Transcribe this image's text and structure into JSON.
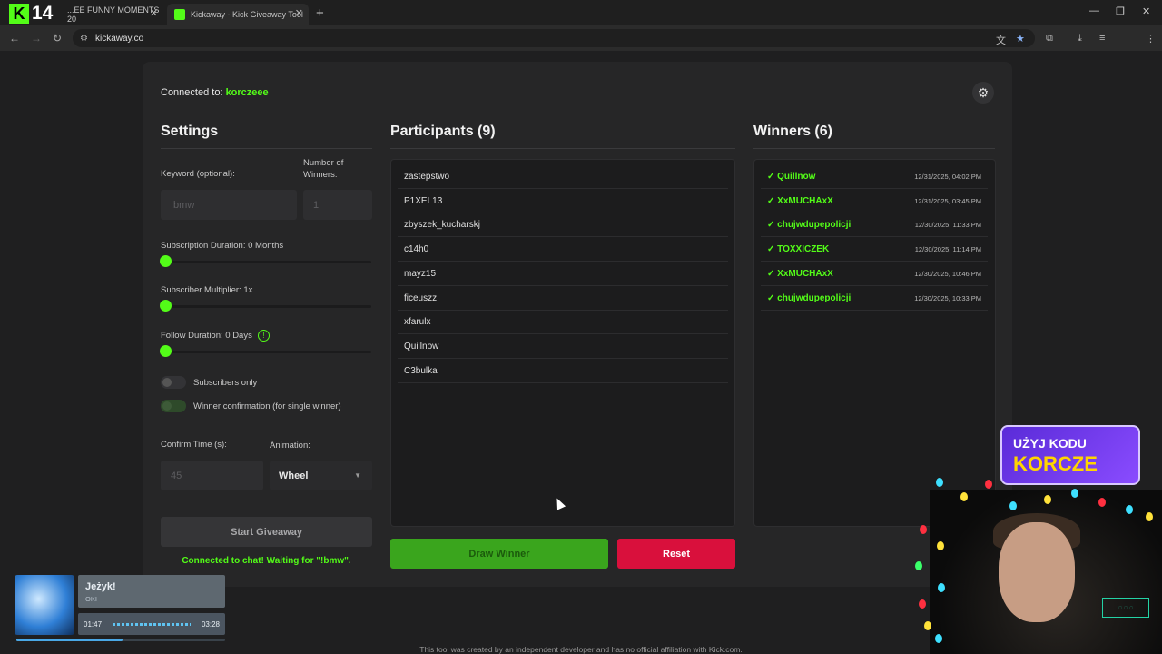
{
  "browser": {
    "tab1_title": "...EE FUNNY MOMENTS 20",
    "tab2_title": "Kickaway - Kick Giveaway Tool",
    "url": "kickaway.co",
    "new_tab": "+",
    "close": "✕",
    "profile_initial": "P"
  },
  "overlay_logo": {
    "k": "K",
    "number": "14"
  },
  "header": {
    "connected_label": "Connected to: ",
    "channel": "korczeee"
  },
  "settings": {
    "title": "Settings",
    "keyword_label": "Keyword (optional):",
    "keyword_placeholder": "!bmw",
    "winners_label": "Number of Winners:",
    "winners_placeholder": "1",
    "subscription_duration": "Subscription Duration: 0 Months",
    "subscriber_multiplier": "Subscriber Multiplier: 1x",
    "follow_duration": "Follow Duration: 0 Days",
    "subscribers_only": "Subscribers only",
    "winner_confirmation": "Winner confirmation (for single winner)",
    "confirm_time_label": "Confirm Time (s):",
    "confirm_time_placeholder": "45",
    "animation_label": "Animation:",
    "animation_value": "Wheel",
    "start_button": "Start Giveaway",
    "status": "Connected to chat! Waiting for \"!bmw\"."
  },
  "participants": {
    "title": "Participants (9)",
    "items": [
      "zastepstwo",
      "P1XEL13",
      "zbyszek_kucharskj",
      "c14h0",
      "mayz15",
      "ficeuszz",
      "xfarulx",
      "Quillnow",
      "C3bulka"
    ]
  },
  "winners": {
    "title": "Winners (6)",
    "items": [
      {
        "name": "✓ Quillnow",
        "date": "12/31/2025, 04:02 PM"
      },
      {
        "name": "✓ XxMUCHAxX",
        "date": "12/31/2025, 03:45 PM"
      },
      {
        "name": "✓ chujwdupepolicji",
        "date": "12/30/2025, 11:33 PM"
      },
      {
        "name": "✓ TOXXICZEK",
        "date": "12/30/2025, 11:14 PM"
      },
      {
        "name": "✓ XxMUCHAxX",
        "date": "12/30/2025, 10:46 PM"
      },
      {
        "name": "✓ chujwdupepolicji",
        "date": "12/30/2025, 10:33 PM"
      }
    ]
  },
  "actions": {
    "draw": "Draw Winner",
    "reset": "Reset"
  },
  "footer": "This tool was created by an independent developer and has no official affiliation with Kick.com.",
  "music": {
    "title": "Jeżyk!",
    "subtitle": "OKI",
    "elapsed": "01:47",
    "total": "03:28",
    "progress": 0.51
  },
  "promo": {
    "line1": "UŻYJ KODU",
    "line2": "KORCZE"
  },
  "colors": {
    "accent": "#53fc18",
    "reset": "#d9103c",
    "draw": "#3aa51d"
  }
}
